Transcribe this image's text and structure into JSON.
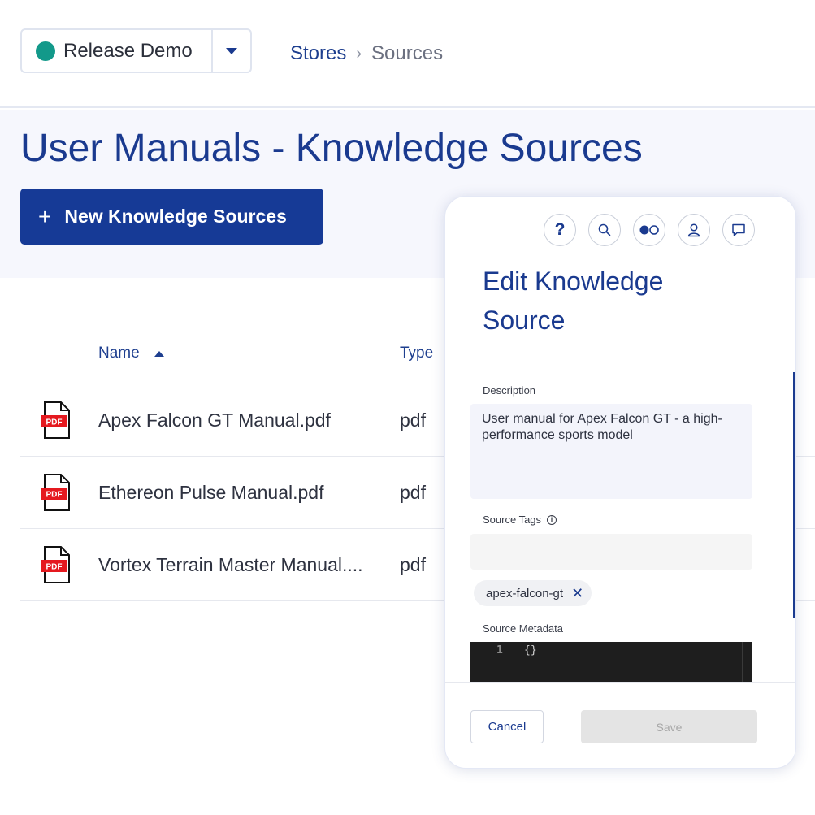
{
  "header": {
    "environment": {
      "label": "Release Demo",
      "status_color": "#12998a"
    },
    "breadcrumb": {
      "parent": "Stores",
      "separator": "›",
      "current": "Sources"
    }
  },
  "page": {
    "title": "User Manuals - Knowledge Sources",
    "new_button_plus": "+",
    "new_button_label": "New Knowledge Sources"
  },
  "table": {
    "columns": {
      "name": "Name",
      "type": "Type"
    },
    "rows": [
      {
        "icon_text": "PDF",
        "name": "Apex Falcon GT Manual.pdf",
        "type": "pdf"
      },
      {
        "icon_text": "PDF",
        "name": "Ethereon Pulse Manual.pdf",
        "type": "pdf"
      },
      {
        "icon_text": "PDF",
        "name": "Vortex Terrain Master Manual....",
        "type": "pdf"
      }
    ]
  },
  "panel": {
    "toolbar_icons": [
      "help-icon",
      "search-icon",
      "toggle-icon",
      "user-icon",
      "chat-icon"
    ],
    "help_glyph": "?",
    "title": "Edit Knowledge Source",
    "description_label": "Description",
    "description_value": "User manual for Apex Falcon GT - a high-performance sports model",
    "tags_label": "Source Tags",
    "tags_info": "i",
    "tags": [
      {
        "label": "apex-falcon-gt",
        "remove": "✕"
      }
    ],
    "metadata_label": "Source Metadata",
    "metadata_line": "1",
    "metadata_code": "{}",
    "cancel_label": "Cancel",
    "save_label": "Save"
  },
  "colors": {
    "brand": "#163a96",
    "accent_text": "#1a3a8f",
    "pdf_red": "#e5191f"
  }
}
